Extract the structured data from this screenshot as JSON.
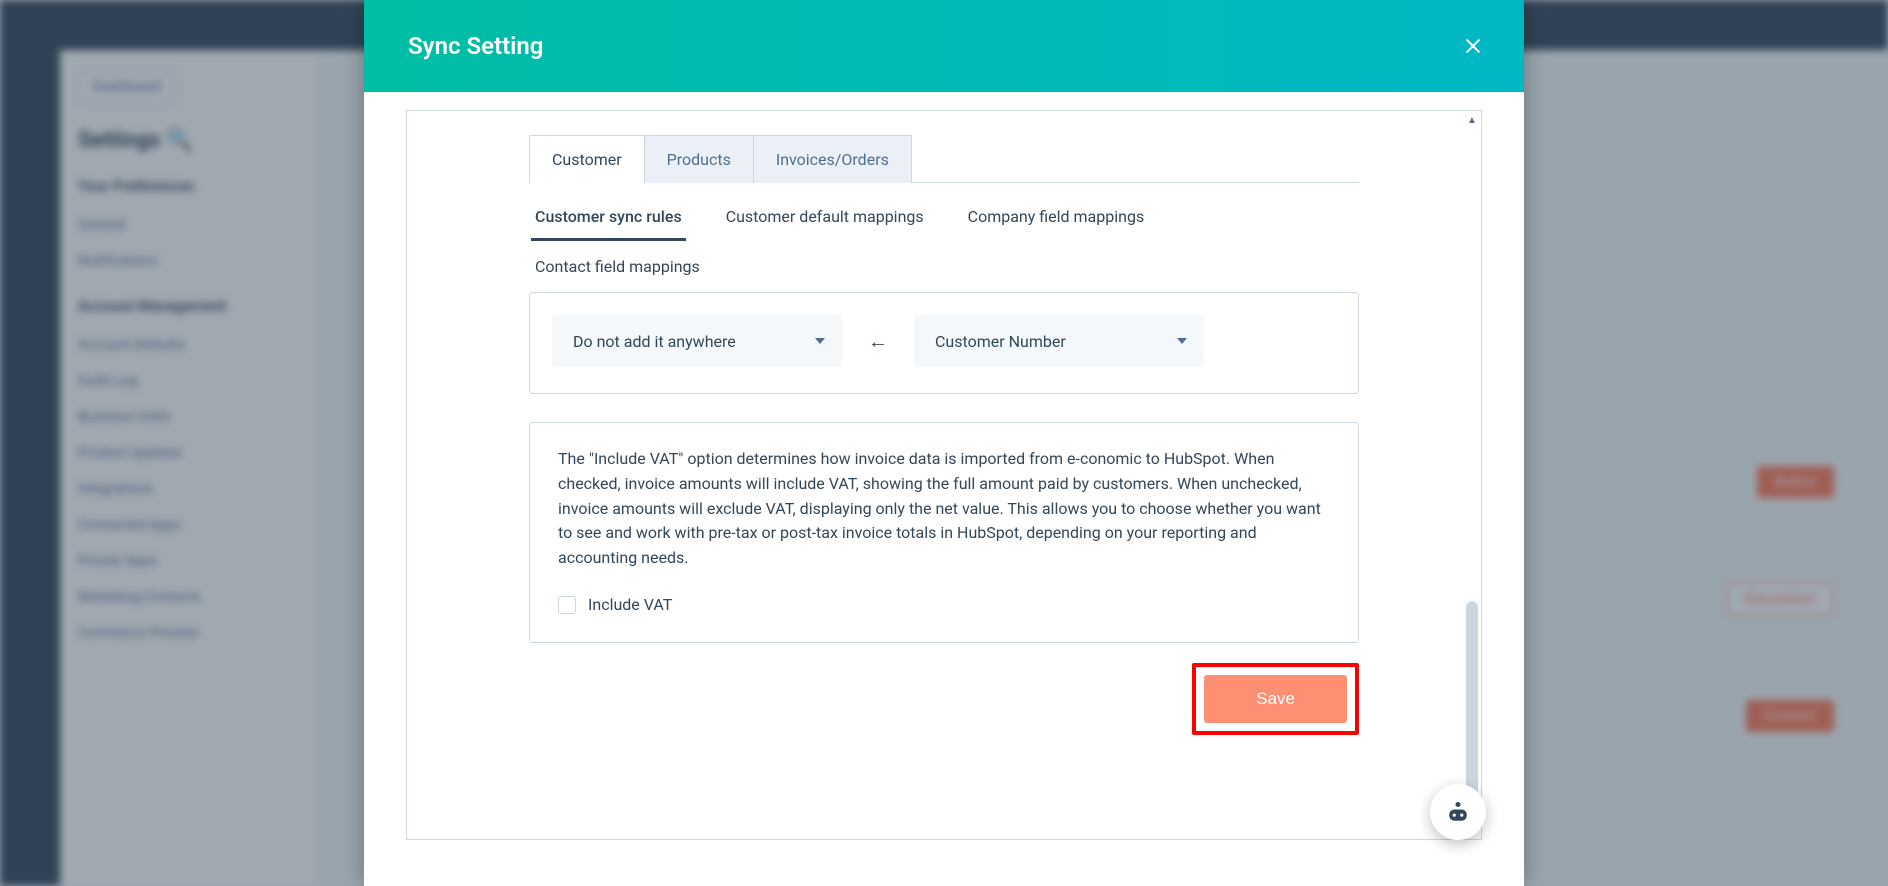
{
  "modal": {
    "title": "Sync Setting",
    "tabs": [
      {
        "label": "Customer",
        "active": true
      },
      {
        "label": "Products",
        "active": false
      },
      {
        "label": "Invoices/Orders",
        "active": false
      }
    ],
    "subtabs": [
      {
        "label": "Customer sync rules",
        "active": true
      },
      {
        "label": "Customer default mappings",
        "active": false
      },
      {
        "label": "Company field mappings",
        "active": false
      },
      {
        "label": "Contact field mappings",
        "active": false
      }
    ],
    "mapping": {
      "left_select": "Do not add it anywhere",
      "right_select": "Customer Number"
    },
    "vat": {
      "text": "The \"Include VAT\" option determines how invoice data is imported from e-conomic to HubSpot. When checked, invoice amounts will include VAT, showing the full amount paid by customers. When unchecked, invoice amounts will exclude VAT, displaying only the net value. This allows you to choose whether you want to see and work with pre-tax or post-tax invoice totals in HubSpot, depending on your reporting and accounting needs.",
      "checkbox_label": "Include VAT",
      "checkbox_checked": false
    },
    "save_label": "Save"
  }
}
